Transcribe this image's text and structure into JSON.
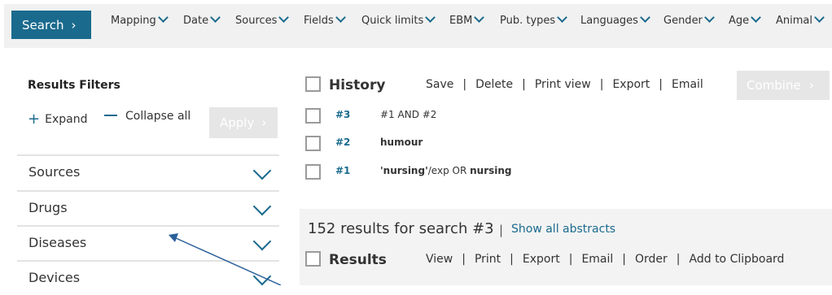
{
  "topbar": {
    "search_label": "Search",
    "menu": [
      "Mapping",
      "Date",
      "Sources",
      "Fields",
      "Quick limits",
      "EBM",
      "Pub. types",
      "Languages",
      "Gender",
      "Age",
      "Animal"
    ]
  },
  "filters": {
    "title": "Results Filters",
    "expand_label": "Expand",
    "collapse_label": "Collapse all",
    "apply_label": "Apply",
    "items": [
      "Sources",
      "Drugs",
      "Diseases",
      "Devices"
    ]
  },
  "history": {
    "title": "History",
    "actions": [
      "Save",
      "Delete",
      "Print view",
      "Export",
      "Email"
    ],
    "combine_label": "Combine",
    "rows": [
      {
        "num": "#3",
        "query": "#1 AND #2"
      },
      {
        "num": "#2",
        "query": "humour"
      },
      {
        "num": "#1",
        "query_part1": "'nursing'",
        "query_part2": "/exp OR ",
        "query_part3": "nursing"
      }
    ]
  },
  "results": {
    "count_text": "152 results for search #3",
    "separator": "|",
    "show_abstracts": "Show all abstracts",
    "title": "Results",
    "actions": [
      "View",
      "Print",
      "Export",
      "Email",
      "Order",
      "Add to Clipboard"
    ]
  },
  "colors": {
    "primary": "#1a6a8d",
    "query_highlight": "#e47a3c",
    "disabled_button": "#e6e6e6"
  }
}
